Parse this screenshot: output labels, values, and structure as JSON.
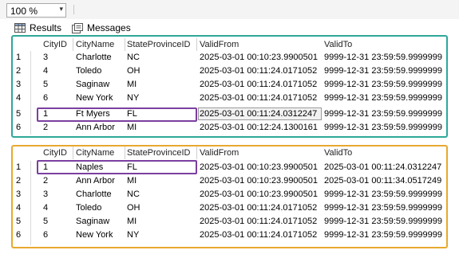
{
  "toolbar": {
    "zoom_value": "100 %",
    "dropdown_glyph": "▾"
  },
  "tabs": {
    "results_label": "Results",
    "messages_label": "Messages"
  },
  "colors": {
    "top_grid_border": "#2ea89a",
    "bottom_grid_border": "#e8a930",
    "highlight": "#7b3fa0"
  },
  "columns": [
    "CityID",
    "CityName",
    "StateProvinceID",
    "ValidFrom",
    "ValidTo"
  ],
  "grid_top": {
    "rows": [
      [
        "1",
        "3",
        "Charlotte",
        "NC",
        "2025-03-01 00:10:23.9900501",
        "9999-12-31 23:59:59.9999999"
      ],
      [
        "2",
        "4",
        "Toledo",
        "OH",
        "2025-03-01 00:11:24.0171052",
        "9999-12-31 23:59:59.9999999"
      ],
      [
        "3",
        "5",
        "Saginaw",
        "MI",
        "2025-03-01 00:11:24.0171052",
        "9999-12-31 23:59:59.9999999"
      ],
      [
        "4",
        "6",
        "New York",
        "NY",
        "2025-03-01 00:11:24.0171052",
        "9999-12-31 23:59:59.9999999"
      ],
      [
        "5",
        "1",
        "Ft Myers",
        "FL",
        "2025-03-01 00:11:24.0312247",
        "9999-12-31 23:59:59.9999999"
      ],
      [
        "6",
        "2",
        "Ann Arbor",
        "MI",
        "2025-03-01 00:12:24.1300161",
        "9999-12-31 23:59:59.9999999"
      ]
    ]
  },
  "grid_bottom": {
    "rows": [
      [
        "1",
        "1",
        "Naples",
        "FL",
        "2025-03-01 00:10:23.9900501",
        "2025-03-01 00:11:24.0312247"
      ],
      [
        "2",
        "2",
        "Ann Arbor",
        "MI",
        "2025-03-01 00:10:23.9900501",
        "2025-03-01 00:11:34.0517249"
      ],
      [
        "3",
        "3",
        "Charlotte",
        "NC",
        "2025-03-01 00:10:23.9900501",
        "9999-12-31 23:59:59.9999999"
      ],
      [
        "4",
        "4",
        "Toledo",
        "OH",
        "2025-03-01 00:11:24.0171052",
        "9999-12-31 23:59:59.9999999"
      ],
      [
        "5",
        "5",
        "Saginaw",
        "MI",
        "2025-03-01 00:11:24.0171052",
        "9999-12-31 23:59:59.9999999"
      ],
      [
        "6",
        "6",
        "New York",
        "NY",
        "2025-03-01 00:11:24.0171052",
        "9999-12-31 23:59:59.9999999"
      ]
    ]
  }
}
